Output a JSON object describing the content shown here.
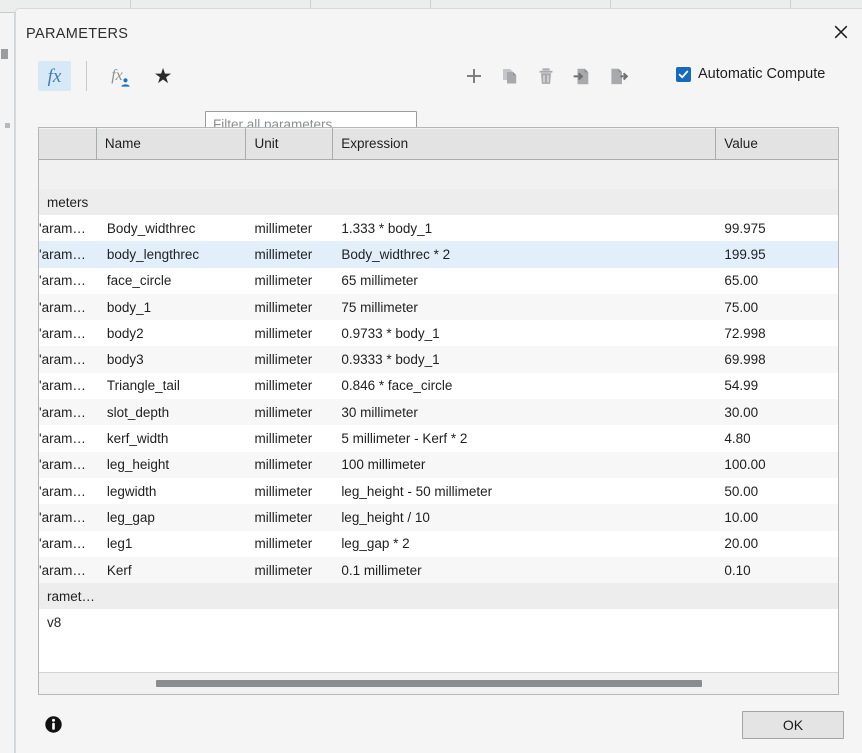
{
  "dialog": {
    "title": "PARAMETERS",
    "close_icon": "close-icon"
  },
  "toolbar": {
    "fx_icon": "fx-icon",
    "fx_label": "fx",
    "user_param_icon": "user-parameter-icon",
    "favorites_icon": "star-icon",
    "favorites_glyph": "★",
    "filter_placeholder": "Filter all parameters",
    "filter_value": "",
    "add_icon": "plus-icon",
    "duplicate_icon": "copy-icon",
    "delete_icon": "trash-icon",
    "import_icon": "import-icon",
    "export_icon": "export-icon",
    "automatic_compute_label": "Automatic Compute",
    "automatic_compute_checked": true,
    "accent_color": "#1669bb",
    "fx_accent_color": "#3f7fb5"
  },
  "table": {
    "columns": [
      "",
      "Name",
      "Unit",
      "Expression",
      "Value"
    ],
    "group_row_label": "meters",
    "tail_row_label": "ramet…",
    "tail_row_value": "v8",
    "selected_row_index": 1,
    "rows": [
      {
        "handle": "'aram…",
        "name": "Body_widthrec",
        "unit": "millimeter",
        "expression": "1.333 * body_1",
        "value": "99.975"
      },
      {
        "handle": "'aram…",
        "name": "body_lengthrec",
        "unit": "millimeter",
        "expression": "Body_widthrec * 2",
        "value": "199.95"
      },
      {
        "handle": "'aram…",
        "name": "face_circle",
        "unit": "millimeter",
        "expression": "65 millimeter",
        "value": "65.00"
      },
      {
        "handle": "'aram…",
        "name": "body_1",
        "unit": "millimeter",
        "expression": "75 millimeter",
        "value": "75.00"
      },
      {
        "handle": "'aram…",
        "name": "body2",
        "unit": "millimeter",
        "expression": "0.9733 * body_1",
        "value": "72.998"
      },
      {
        "handle": "'aram…",
        "name": "body3",
        "unit": "millimeter",
        "expression": "0.9333 * body_1",
        "value": "69.998"
      },
      {
        "handle": "'aram…",
        "name": "Triangle_tail",
        "unit": "millimeter",
        "expression": "0.846 * face_circle",
        "value": "54.99"
      },
      {
        "handle": "'aram…",
        "name": "slot_depth",
        "unit": "millimeter",
        "expression": "30 millimeter",
        "value": "30.00"
      },
      {
        "handle": "'aram…",
        "name": "kerf_width",
        "unit": "millimeter",
        "expression": "5 millimeter - Kerf * 2",
        "value": "4.80"
      },
      {
        "handle": "'aram…",
        "name": "leg_height",
        "unit": "millimeter",
        "expression": "100 millimeter",
        "value": "100.00"
      },
      {
        "handle": "'aram…",
        "name": "legwidth",
        "unit": "millimeter",
        "expression": "leg_height - 50 millimeter",
        "value": "50.00"
      },
      {
        "handle": "'aram…",
        "name": "leg_gap",
        "unit": "millimeter",
        "expression": "leg_height / 10",
        "value": "10.00"
      },
      {
        "handle": "'aram…",
        "name": "leg1",
        "unit": "millimeter",
        "expression": "leg_gap * 2",
        "value": "20.00"
      },
      {
        "handle": "'aram…",
        "name": "Kerf",
        "unit": "millimeter",
        "expression": "0.1 millimeter",
        "value": "0.10"
      }
    ],
    "scrollbar": "horizontal-scrollbar"
  },
  "footer": {
    "info_icon": "info-icon",
    "ok_label": "OK"
  }
}
